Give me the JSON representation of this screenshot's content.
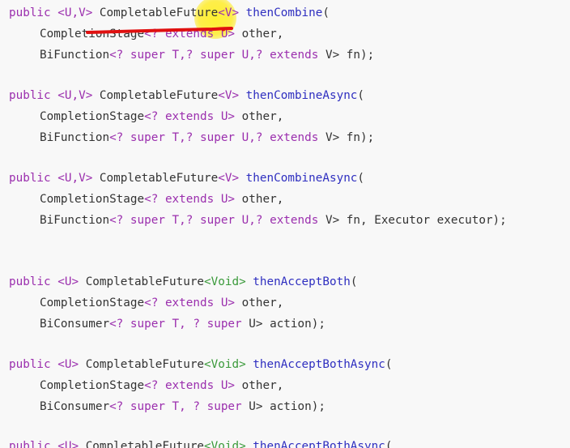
{
  "lines": [
    {
      "k": "public",
      "g": " <U,V>",
      "t": " CompletableFuture",
      "gv": "<V>",
      "f": " thenCombine",
      "p": "("
    },
    {
      "t": "CompletionStage",
      "g": "<?",
      "k": " extends",
      "u": " U>",
      "r": " other,"
    },
    {
      "t": "BiFunction",
      "g": "<?",
      "k1": " super",
      "m": " T,?",
      "k2": " super",
      "m2": " U,?",
      "k3": " extends",
      "r": " V> fn);"
    },
    {
      "k": "public",
      "g": " <U,V>",
      "t": " CompletableFuture",
      "gv": "<V>",
      "f": " thenCombineAsync",
      "p": "("
    },
    {
      "t": "CompletionStage",
      "g": "<?",
      "k": " extends",
      "u": " U>",
      "r": " other,"
    },
    {
      "t": "BiFunction",
      "g": "<?",
      "k1": " super",
      "m": " T,?",
      "k2": " super",
      "m2": " U,?",
      "k3": " extends",
      "r": " V> fn);"
    },
    {
      "k": "public",
      "g": " <U,V>",
      "t": " CompletableFuture",
      "gv": "<V>",
      "f": " thenCombineAsync",
      "p": "("
    },
    {
      "t": "CompletionStage",
      "g": "<?",
      "k": " extends",
      "u": " U>",
      "r": " other,"
    },
    {
      "t": "BiFunction",
      "g": "<?",
      "k1": " super",
      "m": " T,?",
      "k2": " super",
      "m2": " U,?",
      "k3": " extends",
      "r": " V> fn, Executor executor);"
    },
    {
      "k": "public",
      "g": " <U>",
      "t": " CompletableFuture",
      "gv": "<Void>",
      "f": " thenAcceptBoth",
      "p": "("
    },
    {
      "t": "CompletionStage",
      "g": "<?",
      "k": " extends",
      "u": " U>",
      "r": " other,"
    },
    {
      "t": "BiConsumer",
      "g": "<?",
      "k1": " super",
      "m": " T, ?",
      "k2": " super",
      "r": " U> action);"
    },
    {
      "k": "public",
      "g": " <U>",
      "t": " CompletableFuture",
      "gv": "<Void>",
      "f": " thenAcceptBothAsync",
      "p": "("
    },
    {
      "t": "CompletionStage",
      "g": "<?",
      "k": " extends",
      "u": " U>",
      "r": " other,"
    },
    {
      "t": "BiConsumer",
      "g": "<?",
      "k1": " super",
      "m": " T, ?",
      "k2": " super",
      "r": " U> action);"
    },
    {
      "k": "public",
      "g": " <U>",
      "t": " CompletableFuture",
      "gv": "<Void>",
      "f": " thenAcceptBothAsync",
      "p": "("
    }
  ],
  "colors": {
    "background": "#f8f8f8",
    "keyword": "#9b2fae",
    "method": "#2f2fc0",
    "void_type": "#3b9a3b",
    "text": "#333333",
    "annotation_underline": "#e01010",
    "cursor_highlight": "#ffec28"
  }
}
